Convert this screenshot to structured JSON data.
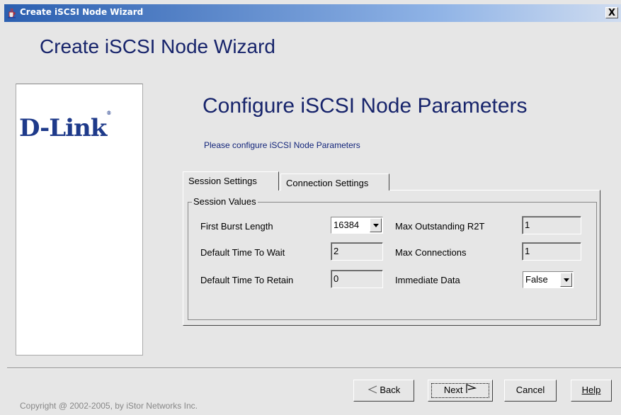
{
  "window": {
    "title": "Create iSCSI Node Wizard",
    "close_label": "X"
  },
  "heading": "Create iSCSI Node Wizard",
  "logo": {
    "text": "D-Link",
    "mark": "®"
  },
  "page": {
    "subheading": "Configure iSCSI Node Parameters",
    "instructions": "Please configure iSCSI Node Parameters"
  },
  "tabs": [
    {
      "label": "Session Settings",
      "active": true
    },
    {
      "label": "Connection Settings",
      "active": false
    }
  ],
  "session": {
    "group_title": "Session Values",
    "first_burst_length": {
      "label": "First Burst Length",
      "value": "16384"
    },
    "default_time_to_wait": {
      "label": "Default Time To Wait",
      "value": "2"
    },
    "default_time_to_retain": {
      "label": "Default Time To Retain",
      "value": "0"
    },
    "max_outstanding_r2t": {
      "label": "Max Outstanding R2T",
      "value": "1"
    },
    "max_connections": {
      "label": "Max Connections",
      "value": "1"
    },
    "immediate_data": {
      "label": "Immediate Data",
      "value": "False"
    }
  },
  "footer": {
    "copyright": "Copyright @ 2002-2005, by iStor Networks Inc.",
    "back_label": "Back",
    "next_label": "Next",
    "cancel_label": "Cancel",
    "help_label": "Help"
  },
  "icons": {
    "app": "java-cup-icon",
    "back": "back-arrow-icon",
    "next": "next-flag-icon",
    "dropdown": "chevron-down-icon"
  }
}
